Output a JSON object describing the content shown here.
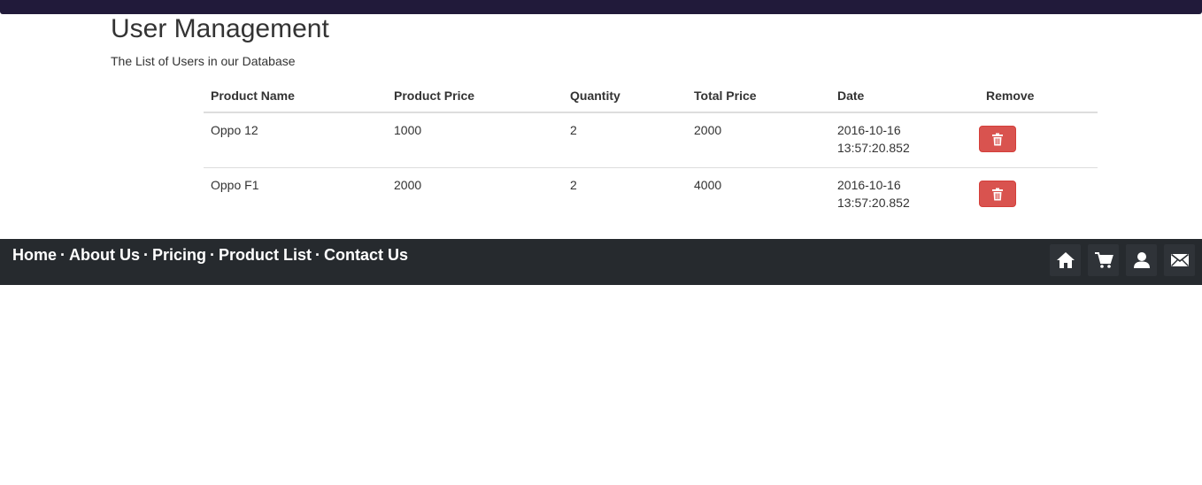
{
  "header": {
    "title": "User Management",
    "subtitle": "The List of Users in our Database"
  },
  "table": {
    "columns": [
      "Product Name",
      "Product Price",
      "Quantity",
      "Total Price",
      "Date",
      "Remove"
    ],
    "rows": [
      {
        "name": "Oppo 12",
        "price": "1000",
        "quantity": "2",
        "total": "2000",
        "date": "2016-10-16",
        "time": "13:57:20.852"
      },
      {
        "name": "Oppo F1",
        "price": "2000",
        "quantity": "2",
        "total": "4000",
        "date": "2016-10-16",
        "time": "13:57:20.852"
      }
    ]
  },
  "footer": {
    "links": [
      "Home",
      "About Us",
      "Pricing",
      "Product List",
      "Contact Us"
    ],
    "separator": "·",
    "icons": [
      "home-icon",
      "cart-icon",
      "user-icon",
      "mail-icon"
    ]
  },
  "colors": {
    "topbar": "#211a3a",
    "footer": "#262a2e",
    "danger": "#d9534f"
  }
}
